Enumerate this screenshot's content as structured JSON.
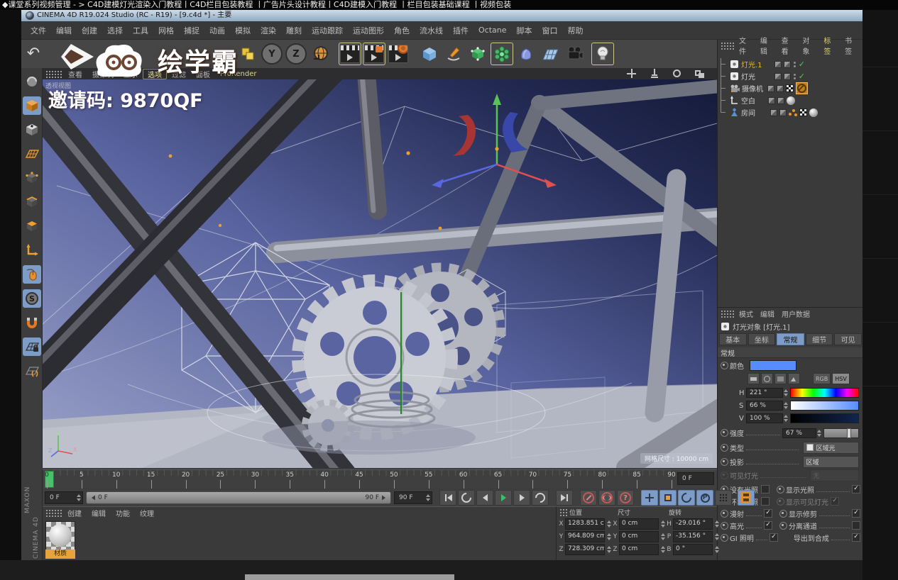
{
  "top_bar": {
    "text": "◆课堂系列视频管理  - > C4D建模灯光渲染入门教程丨C4D栏目包装教程 丨广告片头设计教程丨C4D建模入门教程 丨栏目包装基础课程 丨视频包装"
  },
  "window": {
    "title": "CINEMA 4D R19.024 Studio (RC - R19) - [9.c4d *] - 主要"
  },
  "menu_bar": {
    "items": [
      "文件",
      "编辑",
      "创建",
      "选择",
      "工具",
      "网格",
      "捕捉",
      "动画",
      "模拟",
      "渲染",
      "雕刻",
      "运动跟踪",
      "运动图形",
      "角色",
      "流水线",
      "插件",
      "Octane",
      "脚本",
      "窗口",
      "帮助"
    ]
  },
  "glyphs": {
    "undo": "↶",
    "y": "Y",
    "z": "Z",
    "s": "S",
    "p": "P",
    "question": "?"
  },
  "watermark": {
    "brand": "绘学霸",
    "invite": "邀请码: 9870QF"
  },
  "viewport": {
    "menus": [
      "查看",
      "摄像机",
      "显示",
      "选项",
      "过滤",
      "面板"
    ],
    "prorender": "ProRender",
    "view_label": "透视视图",
    "grid_size": "网格尺寸 : 10000 cm"
  },
  "timeline": {
    "start": 0,
    "end": 90,
    "step": 5,
    "current": "0 F",
    "range_left": "0 F",
    "range_right": "90 F",
    "end_box": "90 F",
    "hud": "0 F"
  },
  "materials": {
    "menus": [
      "创建",
      "编辑",
      "功能",
      "纹理"
    ],
    "items": [
      {
        "name": "材质"
      }
    ]
  },
  "coordinates": {
    "groups": [
      {
        "label": "位置",
        "rows": [
          {
            "axis": "X",
            "value": "1283.851 cm"
          },
          {
            "axis": "Y",
            "value": "964.809 cm"
          },
          {
            "axis": "Z",
            "value": "728.309 cm"
          }
        ]
      },
      {
        "label": "尺寸",
        "rows": [
          {
            "axis": "X",
            "value": "0 cm"
          },
          {
            "axis": "Y",
            "value": "0 cm"
          },
          {
            "axis": "Z",
            "value": "0 cm"
          }
        ]
      },
      {
        "label": "旋转",
        "rows": [
          {
            "axis": "H",
            "value": "-29.016 °"
          },
          {
            "axis": "P",
            "value": "-35.156 °"
          },
          {
            "axis": "B",
            "value": "0 °"
          }
        ]
      }
    ]
  },
  "object_manager": {
    "menus": [
      "文件",
      "编辑",
      "查看",
      "对象",
      "标签",
      "书签"
    ],
    "objects": [
      {
        "name": "灯光.1",
        "selected": true
      },
      {
        "name": "灯光",
        "selected": false
      },
      {
        "name": "摄像机",
        "selected": false
      },
      {
        "name": "空白",
        "selected": false
      },
      {
        "name": "房间",
        "selected": false
      }
    ]
  },
  "attributes": {
    "menus": [
      "模式",
      "编辑",
      "用户数据"
    ],
    "object_title": "灯光对象 [灯光.1]",
    "tabs": [
      "基本",
      "坐标",
      "常规",
      "细节",
      "可见"
    ],
    "active_tab": "常规",
    "section": "常规",
    "color_label": "颜色",
    "color_hex": "#578cff",
    "color_modes": [
      "RGB",
      "HSV"
    ],
    "hsv": [
      {
        "label": "H",
        "value": "221 °"
      },
      {
        "label": "S",
        "value": "66 %"
      },
      {
        "label": "V",
        "value": "100 %"
      }
    ],
    "intensity_label": "强度",
    "intensity_value": "67 %",
    "type_label": "类型",
    "type_value": "区域光",
    "shadow_label": "投影",
    "shadow_value": "区域",
    "visible_light_label": "可见灯光",
    "visible_light_value": "无",
    "checks_left": [
      {
        "label": "没有光照",
        "checked": false
      },
      {
        "label": "环境光照",
        "checked": false
      },
      {
        "label": "漫射",
        "checked": true
      },
      {
        "label": "高光",
        "checked": true
      },
      {
        "label": "GI 照明",
        "checked": true
      }
    ],
    "checks_right": [
      {
        "label": "显示光照",
        "checked": true
      },
      {
        "label": "显示可见灯光",
        "checked": true
      },
      {
        "label": "显示修剪",
        "checked": true
      },
      {
        "label": "分离通道",
        "checked": false
      },
      {
        "label": "导出到合成",
        "checked": true
      }
    ]
  },
  "branding": {
    "maxon": "MAXON",
    "cinema": "CINEMA 4D"
  }
}
